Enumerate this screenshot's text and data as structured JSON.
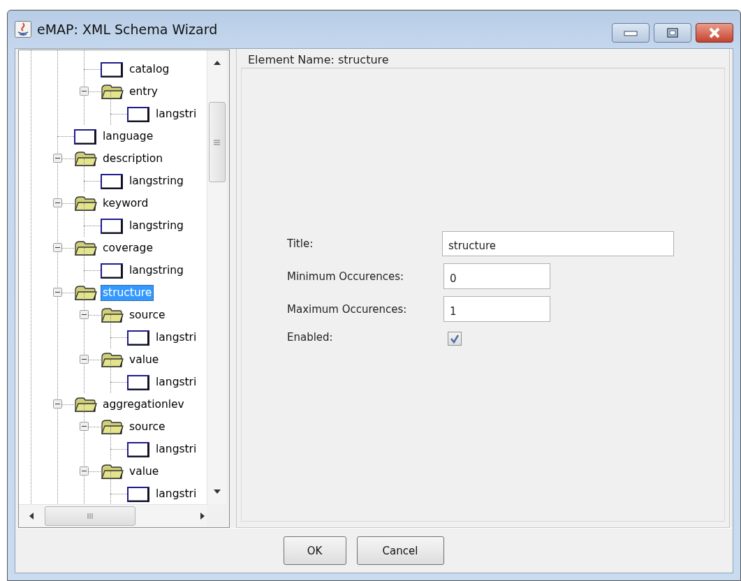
{
  "window": {
    "title": "eMAP: XML Schema Wizard"
  },
  "tree": {
    "nodes": [
      {
        "children": [
          {
            "children": [
              {
                "kind": "leaf",
                "label": "catalog",
                "selected": false
              },
              {
                "kind": "folder",
                "label": "entry",
                "expanded": true,
                "selected": false,
                "children": [
                  {
                    "kind": "leaf",
                    "label": "langstri",
                    "selected": false
                  }
                ]
              }
            ]
          },
          {
            "kind": "leaf",
            "label": "language",
            "selected": false
          },
          {
            "kind": "folder",
            "label": "description",
            "expanded": true,
            "selected": false,
            "children": [
              {
                "kind": "leaf",
                "label": "langstring",
                "selected": false
              }
            ]
          },
          {
            "kind": "folder",
            "label": "keyword",
            "expanded": true,
            "selected": false,
            "children": [
              {
                "kind": "leaf",
                "label": "langstring",
                "selected": false
              }
            ]
          },
          {
            "kind": "folder",
            "label": "coverage",
            "expanded": true,
            "selected": false,
            "children": [
              {
                "kind": "leaf",
                "label": "langstring",
                "selected": false
              }
            ]
          },
          {
            "kind": "folder",
            "label": "structure",
            "expanded": true,
            "selected": true,
            "children": [
              {
                "kind": "folder",
                "label": "source",
                "expanded": true,
                "selected": false,
                "children": [
                  {
                    "kind": "leaf",
                    "label": "langstri",
                    "selected": false
                  }
                ]
              },
              {
                "kind": "folder",
                "label": "value",
                "expanded": true,
                "selected": false,
                "children": [
                  {
                    "kind": "leaf",
                    "label": "langstri",
                    "selected": false
                  }
                ]
              }
            ]
          },
          {
            "kind": "folder",
            "label": "aggregationlev",
            "expanded": true,
            "selected": false,
            "children": [
              {
                "kind": "folder",
                "label": "source",
                "expanded": true,
                "selected": false,
                "children": [
                  {
                    "kind": "leaf",
                    "label": "langstri",
                    "selected": false
                  }
                ]
              },
              {
                "kind": "folder",
                "label": "value",
                "expanded": true,
                "selected": false,
                "children": [
                  {
                    "kind": "leaf",
                    "label": "langstri",
                    "selected": false
                  }
                ]
              }
            ]
          }
        ]
      }
    ]
  },
  "panel": {
    "title": "Element Name: structure",
    "fields": [
      {
        "kind": "text",
        "label": "Title:",
        "value": "structure"
      },
      {
        "kind": "text",
        "label": "Minimum Occurences:",
        "value": "0"
      },
      {
        "kind": "text",
        "label": "Maximum Occurences:",
        "value": "1"
      },
      {
        "kind": "checkbox",
        "label": "Enabled:",
        "checked": true
      }
    ]
  },
  "buttons": [
    "OK",
    "Cancel"
  ]
}
